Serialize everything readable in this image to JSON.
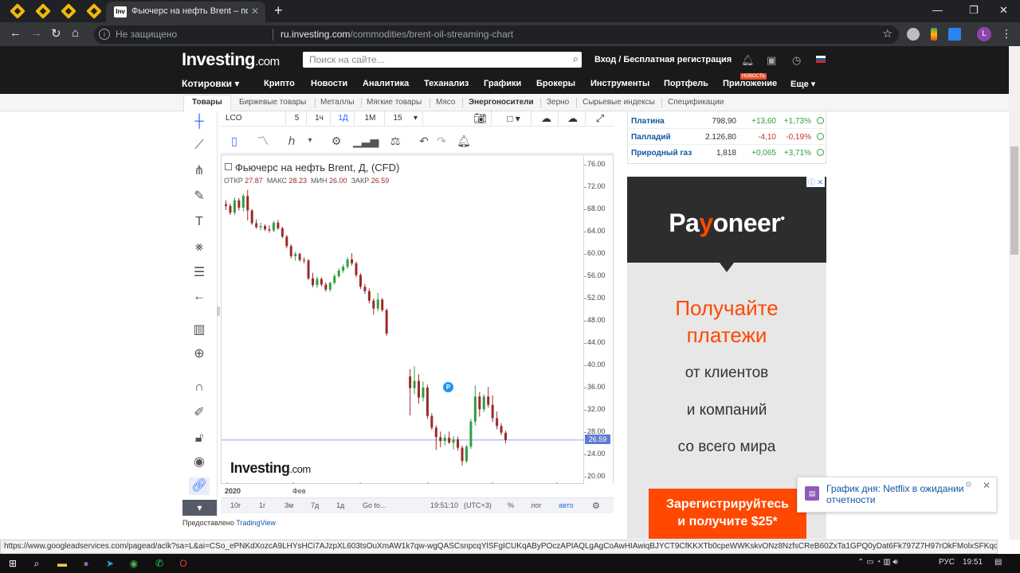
{
  "browser": {
    "tab_title": "Фьючерс на нефть Brent – пото",
    "tab_favicon": "Inv",
    "insecure_label": "Не защищено",
    "url_host": "ru.investing.com",
    "url_path": "/commodities/brent-oil-streaming-chart",
    "profile_initial": "L"
  },
  "site": {
    "logo_main": "Investing",
    "logo_suffix": ".com",
    "search_placeholder": "Поиск на сайте...",
    "login": "Вход / Бесплатная регистрация",
    "nav": [
      "Котировки",
      "Крипто",
      "Новости",
      "Аналитика",
      "Теханализ",
      "Графики",
      "Брокеры",
      "Инструменты",
      "Портфель",
      "Приложение",
      "Еще"
    ],
    "nav_badge": "НОВОСТЬ",
    "subnav": [
      "Товары",
      "Биржевые товары",
      "Металлы",
      "Мягкие товары",
      "Мясо",
      "Энергоносители",
      "Зерно",
      "Сырьевые индексы",
      "Спецификации"
    ]
  },
  "chart_toolbar": {
    "symbol": "LCO",
    "intervals": [
      "5",
      "1ч",
      "1Д",
      "1М",
      "15"
    ],
    "active_interval": "1Д"
  },
  "chart": {
    "title": "Фьючерс на нефть Brent, Д, (CFD)",
    "ohlc_labels": [
      "ОТКР",
      "МАКС",
      "МИН",
      "ЗАКР"
    ],
    "ohlc_values": [
      "27.87",
      "28.23",
      "26.00",
      "26.59"
    ],
    "last_price": "26.59",
    "watermark_main": "Investing",
    "watermark_suffix": ".com",
    "event_marker": "P",
    "bottom": {
      "ranges": [
        "10г",
        "1г",
        "3м",
        "7д",
        "1д"
      ],
      "goto": "Go to...",
      "time": "19:51:10",
      "tz": "(UTC+3)",
      "pct": "%",
      "log": "лог",
      "auto": "авто"
    },
    "provided_by": "Предоставлено",
    "provider": "TradingView"
  },
  "chart_data": {
    "type": "candlestick",
    "x_tick_labels": [
      "2020",
      "Фев"
    ],
    "y_ticks": [
      "76.00",
      "72.00",
      "68.00",
      "64.00",
      "60.00",
      "56.00",
      "52.00",
      "48.00",
      "44.00",
      "40.00",
      "36.00",
      "32.00",
      "28.00",
      "24.00",
      "20.00"
    ],
    "ylim": [
      18,
      78
    ],
    "colors": {
      "up": "#2e9e44",
      "down": "#9c2a2a"
    },
    "candles": [
      {
        "o": 68.9,
        "h": 69.6,
        "l": 67.9,
        "c": 68.6
      },
      {
        "o": 68.6,
        "h": 69.0,
        "l": 67.0,
        "c": 67.4
      },
      {
        "o": 67.4,
        "h": 70.1,
        "l": 67.0,
        "c": 69.6
      },
      {
        "o": 69.6,
        "h": 70.0,
        "l": 67.8,
        "c": 68.3
      },
      {
        "o": 68.3,
        "h": 70.8,
        "l": 67.6,
        "c": 70.4
      },
      {
        "o": 70.4,
        "h": 71.5,
        "l": 66.0,
        "c": 67.8
      },
      {
        "o": 67.8,
        "h": 68.0,
        "l": 65.2,
        "c": 65.5
      },
      {
        "o": 65.5,
        "h": 66.2,
        "l": 64.5,
        "c": 64.8
      },
      {
        "o": 64.8,
        "h": 65.6,
        "l": 64.2,
        "c": 65.0
      },
      {
        "o": 65.0,
        "h": 65.3,
        "l": 64.1,
        "c": 64.4
      },
      {
        "o": 64.4,
        "h": 65.1,
        "l": 63.8,
        "c": 64.2
      },
      {
        "o": 64.2,
        "h": 65.9,
        "l": 63.9,
        "c": 65.6
      },
      {
        "o": 65.6,
        "h": 66.1,
        "l": 64.3,
        "c": 64.6
      },
      {
        "o": 64.6,
        "h": 64.9,
        "l": 62.8,
        "c": 63.1
      },
      {
        "o": 63.1,
        "h": 63.4,
        "l": 61.0,
        "c": 61.4
      },
      {
        "o": 61.4,
        "h": 61.7,
        "l": 59.2,
        "c": 59.6
      },
      {
        "o": 59.6,
        "h": 60.4,
        "l": 58.8,
        "c": 60.0
      },
      {
        "o": 60.0,
        "h": 60.2,
        "l": 58.6,
        "c": 58.9
      },
      {
        "o": 58.9,
        "h": 59.4,
        "l": 58.3,
        "c": 58.8
      },
      {
        "o": 58.8,
        "h": 59.1,
        "l": 55.3,
        "c": 55.6
      },
      {
        "o": 55.6,
        "h": 56.6,
        "l": 54.0,
        "c": 54.4
      },
      {
        "o": 54.4,
        "h": 55.9,
        "l": 53.9,
        "c": 55.5
      },
      {
        "o": 55.5,
        "h": 55.8,
        "l": 54.1,
        "c": 54.5
      },
      {
        "o": 54.5,
        "h": 54.9,
        "l": 53.2,
        "c": 53.6
      },
      {
        "o": 53.6,
        "h": 55.0,
        "l": 53.2,
        "c": 54.8
      },
      {
        "o": 54.8,
        "h": 56.4,
        "l": 54.5,
        "c": 56.0
      },
      {
        "o": 56.0,
        "h": 57.4,
        "l": 55.7,
        "c": 57.0
      },
      {
        "o": 57.0,
        "h": 58.1,
        "l": 56.6,
        "c": 57.7
      },
      {
        "o": 57.7,
        "h": 59.4,
        "l": 57.3,
        "c": 59.0
      },
      {
        "o": 59.0,
        "h": 60.1,
        "l": 57.9,
        "c": 58.3
      },
      {
        "o": 58.3,
        "h": 58.6,
        "l": 55.8,
        "c": 56.2
      },
      {
        "o": 56.2,
        "h": 56.5,
        "l": 53.7,
        "c": 54.1
      },
      {
        "o": 54.1,
        "h": 54.6,
        "l": 52.8,
        "c": 53.3
      },
      {
        "o": 53.3,
        "h": 53.8,
        "l": 51.1,
        "c": 51.6
      },
      {
        "o": 51.6,
        "h": 52.0,
        "l": 49.1,
        "c": 50.2
      },
      {
        "o": 50.2,
        "h": 53.0,
        "l": 49.7,
        "c": 51.8
      },
      {
        "o": 51.8,
        "h": 52.1,
        "l": 49.6,
        "c": 49.9
      },
      {
        "o": 49.9,
        "h": 50.2,
        "l": 45.3,
        "c": 45.7
      },
      {
        "o": 38.0,
        "h": 39.3,
        "l": 31.0,
        "c": 35.9
      },
      {
        "o": 35.9,
        "h": 39.8,
        "l": 34.8,
        "c": 37.2
      },
      {
        "o": 37.2,
        "h": 38.4,
        "l": 33.1,
        "c": 34.2
      },
      {
        "o": 34.2,
        "h": 37.1,
        "l": 33.5,
        "c": 36.0
      },
      {
        "o": 36.0,
        "h": 36.5,
        "l": 30.4,
        "c": 30.9
      },
      {
        "o": 30.9,
        "h": 31.4,
        "l": 28.4,
        "c": 28.8
      },
      {
        "o": 28.8,
        "h": 29.2,
        "l": 24.8,
        "c": 27.1
      },
      {
        "o": 27.1,
        "h": 28.1,
        "l": 25.3,
        "c": 26.4
      },
      {
        "o": 26.4,
        "h": 27.6,
        "l": 25.6,
        "c": 27.0
      },
      {
        "o": 27.0,
        "h": 28.1,
        "l": 25.9,
        "c": 26.1
      },
      {
        "o": 26.1,
        "h": 27.3,
        "l": 24.9,
        "c": 26.7
      },
      {
        "o": 26.7,
        "h": 27.2,
        "l": 24.7,
        "c": 25.2
      },
      {
        "o": 25.2,
        "h": 25.6,
        "l": 22.0,
        "c": 22.8
      },
      {
        "o": 22.8,
        "h": 25.7,
        "l": 22.5,
        "c": 25.4
      },
      {
        "o": 25.4,
        "h": 30.4,
        "l": 25.0,
        "c": 29.9
      },
      {
        "o": 29.9,
        "h": 36.4,
        "l": 29.2,
        "c": 34.4
      },
      {
        "o": 34.4,
        "h": 35.2,
        "l": 30.8,
        "c": 32.1
      },
      {
        "o": 32.1,
        "h": 34.8,
        "l": 31.6,
        "c": 34.4
      },
      {
        "o": 34.4,
        "h": 36.1,
        "l": 32.4,
        "c": 32.9
      },
      {
        "o": 32.9,
        "h": 34.6,
        "l": 29.8,
        "c": 30.5
      },
      {
        "o": 30.5,
        "h": 31.7,
        "l": 28.5,
        "c": 29.1
      },
      {
        "o": 29.1,
        "h": 29.6,
        "l": 27.5,
        "c": 27.9
      },
      {
        "o": 27.87,
        "h": 28.23,
        "l": 26.0,
        "c": 26.59
      }
    ],
    "gap_after_index": 37,
    "price_line": 26.59
  },
  "quotes": [
    {
      "name": "Платина",
      "value": "798,90",
      "change": "+13,60",
      "pct": "+1,73%",
      "dir": "pos"
    },
    {
      "name": "Палладий",
      "value": "2.126,80",
      "change": "-4,10",
      "pct": "-0,19%",
      "dir": "neg"
    },
    {
      "name": "Природный газ",
      "value": "1,818",
      "change": "+0,065",
      "pct": "+3,71%",
      "dir": "pos"
    }
  ],
  "ad": {
    "brand_pre": "Pa",
    "brand_mid": "y",
    "brand_post": "oneer",
    "line1": "Получайте",
    "line2": "платежи",
    "line3": "от клиентов",
    "line4": "и компаний",
    "line5": "со всего мира",
    "cta1": "Зарегистрируйтесь",
    "cta2": "и получите $25*"
  },
  "notification": {
    "text": "График дня: Netflix в ожидании отчетности"
  },
  "status_url": "https://www.googleadservices.com/pagead/aclk?sa=L&ai=CSo_ePNKdXozcA9LHYsHCi7AJzpXL603tsOuXmAW1k7qw-wgQASCsnpcqYlSFgICUKqAByPOczAPIAQLgAgCoAwHIAwiqBJYCT9CfKKXTb0cpeWWKskvONz8NzfsCReB60ZxTa1GPQ0yDat6Fk797Z7H97rOkFMolxSFKqq87KsqT7Jo...",
  "taskbar": {
    "lang": "РУС",
    "clock": "19:51"
  }
}
